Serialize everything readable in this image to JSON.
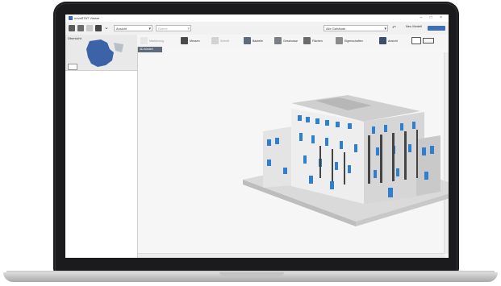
{
  "app": {
    "title": "novaSTAT Viewer",
    "window_controls": "– □ ×"
  },
  "toolbar": {
    "view_select": "Ansicht",
    "layer_select": "Ebene",
    "search_select": "Alle Gebäude",
    "right_button_label": "Neu Modell"
  },
  "sidebar": {
    "map_label": "Übersicht"
  },
  "ribbon": {
    "items": [
      {
        "label": "Markierung"
      },
      {
        "label": "Messen"
      },
      {
        "label": "Schnitt"
      },
      {
        "label": "Bauteile"
      },
      {
        "label": "Geschosse"
      },
      {
        "label": "Flächen"
      },
      {
        "label": "Eigenschaften"
      },
      {
        "label": "Ansicht"
      }
    ]
  },
  "viewer": {
    "tab_label": "3D-Modell"
  },
  "colors": {
    "accent": "#3c6fb4",
    "window_blue": "#2f7fd0",
    "frame": "#1b1b1d"
  }
}
